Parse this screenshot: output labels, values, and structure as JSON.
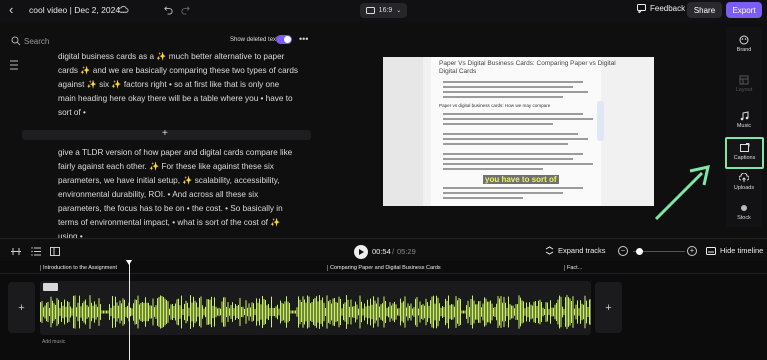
{
  "header": {
    "title": "cool video | Dec 2, 2024...",
    "aspect_ratio": "16:9",
    "feedback_label": "Feedback",
    "share_label": "Share",
    "export_label": "Export",
    "accent_color": "#7b5cf5"
  },
  "transcript": {
    "search_placeholder": "Search",
    "show_deleted_label": "Show deleted text",
    "show_deleted_on": true,
    "paragraphs": [
      "digital business cards as a ✨ much better alternative to paper cards ✨ and we are basically comparing these two types of cards against ✨ six ✨ factors right • so at first like that is only one main heading here okay there will be a table where you • have to sort of •",
      "give a TLDR version of how paper and digital cards compare like fairly against each other. ✨ For these like against these six parameters, we have initial setup, ✨ scalability, accessibility, environmental durability, ROI. • And across all these six parameters, the focus has to be on • the cost. • So basically in terms of environmental impact, • what is sort of the cost of ✨ using •"
    ]
  },
  "preview": {
    "doc_title": "Paper Vs Digital Business Cards: Comparing Paper vs Digital",
    "doc_subtitle": "Digital Cards",
    "doc_heading": "Paper vs digital business cards: How we may compare",
    "caption_text": "you have to sort of"
  },
  "right_rail": {
    "items": [
      {
        "label": "Brand",
        "icon": "palette-icon",
        "disabled": false
      },
      {
        "label": "Layout",
        "icon": "layout-icon",
        "disabled": true
      },
      {
        "label": "Music",
        "icon": "music-icon",
        "disabled": false
      },
      {
        "label": "Captions",
        "icon": "captions-icon",
        "disabled": false,
        "highlighted": true
      },
      {
        "label": "Uploads",
        "icon": "upload-icon",
        "disabled": false
      },
      {
        "label": "Stock",
        "icon": "stock-icon",
        "disabled": false
      }
    ],
    "highlight_color": "#7ee6a6"
  },
  "playback": {
    "current_time": "00:54",
    "separator": "/",
    "total_time": "05:29",
    "expand_tracks_label": "Expand tracks",
    "hide_timeline_label": "Hide timeline",
    "zoom_level": 0.05
  },
  "timeline": {
    "chapters": [
      {
        "label": "Introduction to the Assignment"
      },
      {
        "label": "Comparing Paper and Digital Business Cards"
      },
      {
        "label": "Fact..."
      }
    ],
    "add_music_label": "Add music",
    "waveform_color": "#c9f25e",
    "playhead_time": "00:54"
  }
}
